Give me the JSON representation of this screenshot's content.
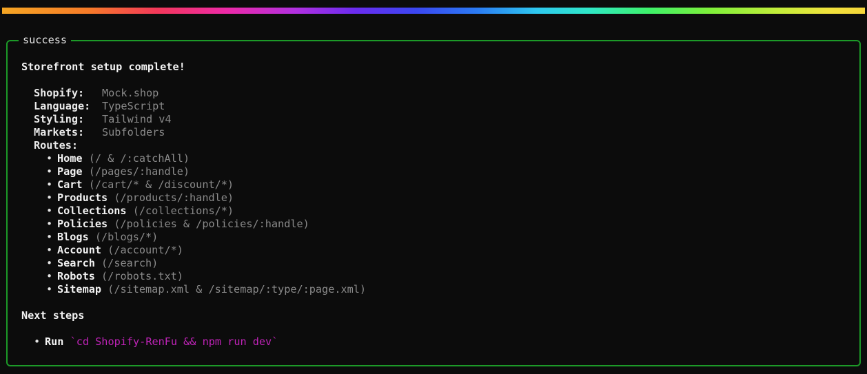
{
  "colors": {
    "border": "#1c9a28",
    "background": "#0c0c0c",
    "muted_text": "#8a8a8a",
    "command_text": "#c023b8"
  },
  "box": {
    "title": "success",
    "heading": "Storefront setup complete!",
    "summary": [
      {
        "key": "Shopify:",
        "value": "Mock.shop"
      },
      {
        "key": "Language:",
        "value": "TypeScript"
      },
      {
        "key": "Styling:",
        "value": "Tailwind v4"
      },
      {
        "key": "Markets:",
        "value": "Subfolders"
      }
    ],
    "routes_label": "Routes:",
    "routes": [
      {
        "name": "Home",
        "path": "(/ & /:catchAll)"
      },
      {
        "name": "Page",
        "path": "(/pages/:handle)"
      },
      {
        "name": "Cart",
        "path": "(/cart/* & /discount/*)"
      },
      {
        "name": "Products",
        "path": "(/products/:handle)"
      },
      {
        "name": "Collections",
        "path": "(/collections/*)"
      },
      {
        "name": "Policies",
        "path": "(/policies & /policies/:handle)"
      },
      {
        "name": "Blogs",
        "path": "(/blogs/*)"
      },
      {
        "name": "Account",
        "path": "(/account/*)"
      },
      {
        "name": "Search",
        "path": "(/search)"
      },
      {
        "name": "Robots",
        "path": "(/robots.txt)"
      },
      {
        "name": "Sitemap",
        "path": "(/sitemap.xml & /sitemap/:type/:page.xml)"
      }
    ],
    "next_steps_heading": "Next steps",
    "next_steps": [
      {
        "label": "Run",
        "command": "`cd Shopify-RenFu && npm run dev`"
      }
    ]
  }
}
